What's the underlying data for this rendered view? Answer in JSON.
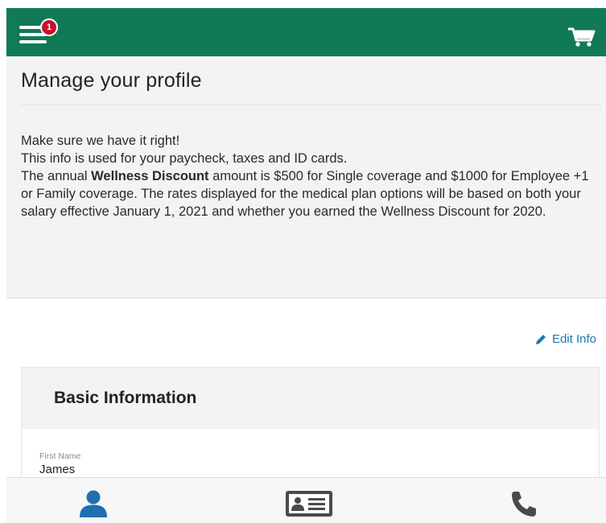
{
  "header": {
    "notification_count": "1",
    "brand_color": "#0f7a55",
    "menu_icon": "hamburger-menu-icon",
    "cart_icon": "shopping-cart-icon"
  },
  "page": {
    "title": "Manage your profile",
    "intro": {
      "line1": "Make sure we have it right!",
      "line2": "This info is used for your paycheck, taxes and ID cards.",
      "wellness_prefix": "The annual ",
      "wellness_bold": "Wellness Discount",
      "wellness_rest": " amount is $500 for Single coverage and $1000 for Employee +1 or Family coverage.  The rates displayed for the medical plan options will be based on both your salary effective January 1, 2021 and whether you earned the Wellness Discount for 2020."
    }
  },
  "actions": {
    "edit_info_label": "Edit Info",
    "edit_icon": "pencil-icon"
  },
  "basic_info": {
    "heading": "Basic Information",
    "fields": [
      {
        "label": "First Name",
        "value": "James"
      }
    ]
  },
  "bottom_nav": {
    "items": [
      {
        "icon": "person-icon"
      },
      {
        "icon": "id-card-icon"
      },
      {
        "icon": "phone-icon"
      }
    ],
    "accent_color": "#1f6fb2"
  }
}
